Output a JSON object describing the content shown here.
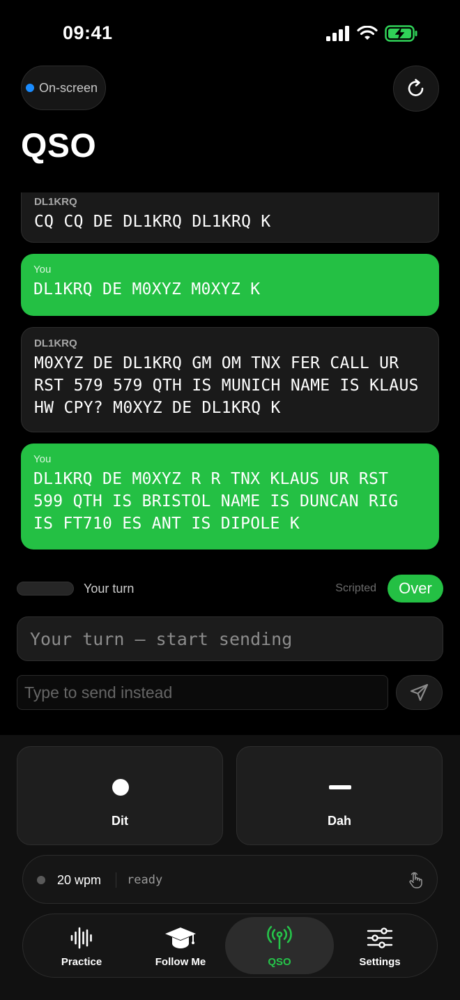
{
  "status_bar": {
    "time": "09:41"
  },
  "header": {
    "onscreen_label": "On-screen",
    "title": "QSO"
  },
  "messages": [
    {
      "sender": "DL1KRQ",
      "text": "CQ CQ DE DL1KRQ DL1KRQ K",
      "from": "them"
    },
    {
      "sender": "You",
      "text": "DL1KRQ DE M0XYZ M0XYZ K",
      "from": "you"
    },
    {
      "sender": "DL1KRQ",
      "text": "M0XYZ DE DL1KRQ GM OM TNX FER CALL UR RST 579 579 QTH IS MUNICH NAME IS KLAUS HW CPY? M0XYZ DE DL1KRQ K",
      "from": "them"
    },
    {
      "sender": "You",
      "text": "DL1KRQ DE M0XYZ R R TNX KLAUS UR RST 599 QTH IS BRISTOL NAME IS DUNCAN RIG IS FT710 ES ANT IS DIPOLE K",
      "from": "you"
    }
  ],
  "turn": {
    "label": "Your turn",
    "scripted_label": "Scripted",
    "over_label": "Over"
  },
  "send_box": {
    "text": "Your turn — start sending"
  },
  "type_input": {
    "placeholder": "Type to send instead",
    "value": ""
  },
  "keys": {
    "dit_label": "Dit",
    "dah_label": "Dah"
  },
  "wpm_bar": {
    "wpm": "20 wpm",
    "status": "ready"
  },
  "tabs": [
    {
      "label": "Practice",
      "icon": "waveform-icon",
      "active": false
    },
    {
      "label": "Follow Me",
      "icon": "graduation-cap-icon",
      "active": false
    },
    {
      "label": "QSO",
      "icon": "antenna-icon",
      "active": true
    },
    {
      "label": "Settings",
      "icon": "sliders-icon",
      "active": false
    }
  ],
  "colors": {
    "accent_green": "#24c044",
    "onscreen_dot": "#1a8cff",
    "battery_green": "#30d158"
  }
}
